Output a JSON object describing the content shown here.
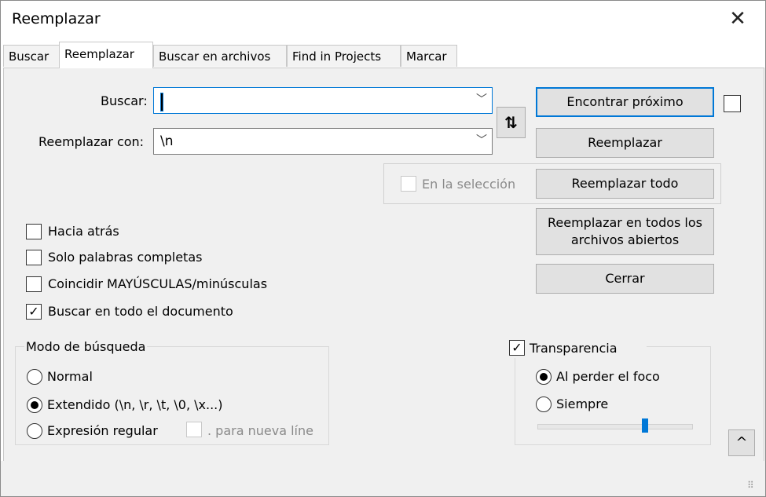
{
  "window": {
    "title": "Reemplazar",
    "close_glyph": "✕"
  },
  "tabs": [
    {
      "label": "Buscar",
      "active": false
    },
    {
      "label": "Reemplazar",
      "active": true
    },
    {
      "label": "Buscar en archivos",
      "active": false
    },
    {
      "label": "Find in Projects",
      "active": false
    },
    {
      "label": "Marcar",
      "active": false
    }
  ],
  "search": {
    "label": "Buscar:",
    "value": ""
  },
  "replace": {
    "label": "Reemplazar con:",
    "value": "\\n"
  },
  "swap_glyph": "⇅",
  "buttons": {
    "find_next": "Encontrar próximo",
    "replace": "Reemplazar",
    "replace_all": "Reemplazar todo",
    "replace_all_open_line1": "Reemplazar en todos los",
    "replace_all_open_line2": "archivos abiertos",
    "close": "Cerrar",
    "collapse": "^"
  },
  "in_selection": {
    "label": "En la selección",
    "checked": false,
    "enabled": false
  },
  "options": [
    {
      "label": "Hacia atrás",
      "checked": false
    },
    {
      "label": "Solo palabras completas",
      "checked": false
    },
    {
      "label": "Coincidir MAYÚSCULAS/minúsculas",
      "checked": false
    },
    {
      "label": "Buscar en todo el documento",
      "checked": true
    }
  ],
  "search_mode": {
    "title": "Modo de búsqueda",
    "normal": "Normal",
    "extended": "Extendido (\\n, \\r, \\t, \\0, \\x...)",
    "regex": "Expresión regular",
    "dot_newline": ". para nueva líne",
    "selected": "extended"
  },
  "transparency": {
    "label": "Transparencia",
    "checked": true,
    "on_lose_focus": "Al perder el foco",
    "always": "Siempre",
    "selected": "on_lose_focus",
    "level_percent": 70
  },
  "check_glyph": "✓"
}
